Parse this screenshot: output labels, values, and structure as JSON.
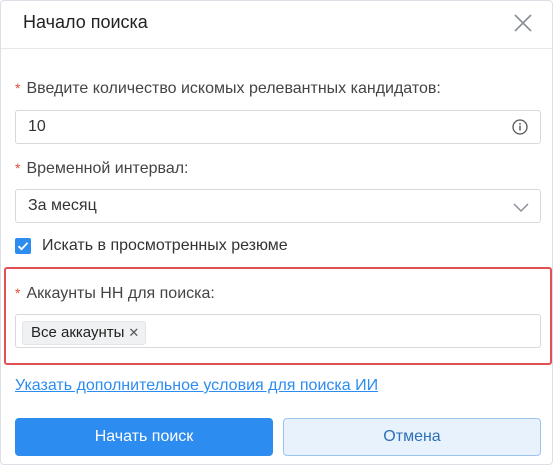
{
  "dialog": {
    "title": "Начало поиска"
  },
  "fields": {
    "count": {
      "label": "Введите количество искомых релевантных кандидатов",
      "value": "10"
    },
    "interval": {
      "label": "Временной интервал",
      "value": "За месяц"
    },
    "search_viewed": {
      "label": "Искать в просмотренных резюме",
      "checked": true
    },
    "accounts": {
      "label": "Аккаунты HH для поиска",
      "tags": [
        "Все аккаунты"
      ]
    }
  },
  "extra_link": "Указать дополнительное условия для поиска ИИ",
  "buttons": {
    "start": "Начать поиск",
    "cancel": "Отмена"
  },
  "colors": {
    "accent": "#2d8cf0",
    "required": "#e74c3c",
    "highlight": "#e05252"
  }
}
